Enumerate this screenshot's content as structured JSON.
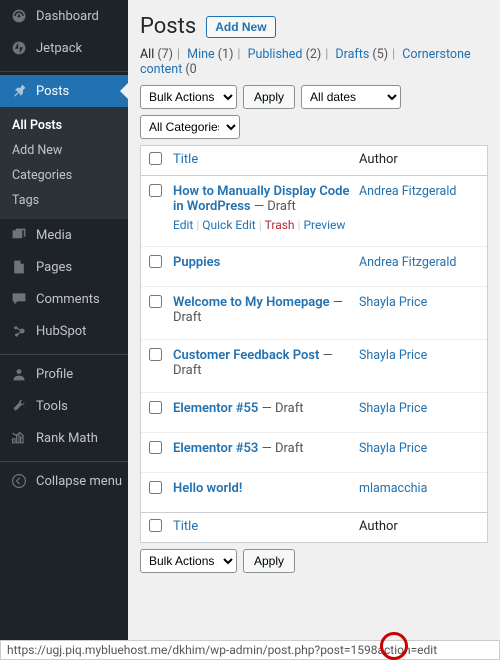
{
  "sidebar": {
    "items": [
      {
        "label": "Dashboard"
      },
      {
        "label": "Jetpack"
      },
      {
        "label": "Posts"
      },
      {
        "label": "Media"
      },
      {
        "label": "Pages"
      },
      {
        "label": "Comments"
      },
      {
        "label": "HubSpot"
      },
      {
        "label": "Profile"
      },
      {
        "label": "Tools"
      },
      {
        "label": "Rank Math"
      },
      {
        "label": "Collapse menu"
      }
    ],
    "submenu": [
      {
        "label": "All Posts"
      },
      {
        "label": "Add New"
      },
      {
        "label": "Categories"
      },
      {
        "label": "Tags"
      }
    ]
  },
  "page": {
    "title": "Posts",
    "add_new": "Add New"
  },
  "filters": {
    "all": "All",
    "all_count": "(7)",
    "mine": "Mine",
    "mine_count": "(1)",
    "published": "Published",
    "published_count": "(2)",
    "drafts": "Drafts",
    "drafts_count": "(5)",
    "cornerstone": "Cornerstone content",
    "cornerstone_count": "(0"
  },
  "bulk": {
    "label": "Bulk Actions",
    "apply": "Apply",
    "dates": "All dates",
    "categories": "All Categories"
  },
  "table": {
    "col_title": "Title",
    "col_author": "Author",
    "rows": [
      {
        "title": "How to Manually Display Code in WordPress",
        "status": " — Draft",
        "author": "Andrea Fitzgerald",
        "show_actions": true
      },
      {
        "title": "Puppies",
        "status": "",
        "author": "Andrea Fitzgerald"
      },
      {
        "title": "Welcome to My Homepage",
        "status": " — Draft",
        "author": "Shayla Price"
      },
      {
        "title": "Customer Feedback Post",
        "status": " — Draft",
        "author": "Shayla Price"
      },
      {
        "title": "Elementor #55",
        "status": " — Draft",
        "author": "Shayla Price"
      },
      {
        "title": "Elementor #53",
        "status": " — Draft",
        "author": "Shayla Price"
      },
      {
        "title": "Hello world!",
        "status": "",
        "author": "mlamacchia"
      }
    ]
  },
  "row_actions": {
    "edit": "Edit",
    "quick": "Quick Edit",
    "trash": "Trash",
    "preview": "Preview"
  },
  "statusbar": {
    "url": "https://ugj.piq.mybluehost.me/dkhim/wp-admin/post.php?post=1598action=edit"
  }
}
